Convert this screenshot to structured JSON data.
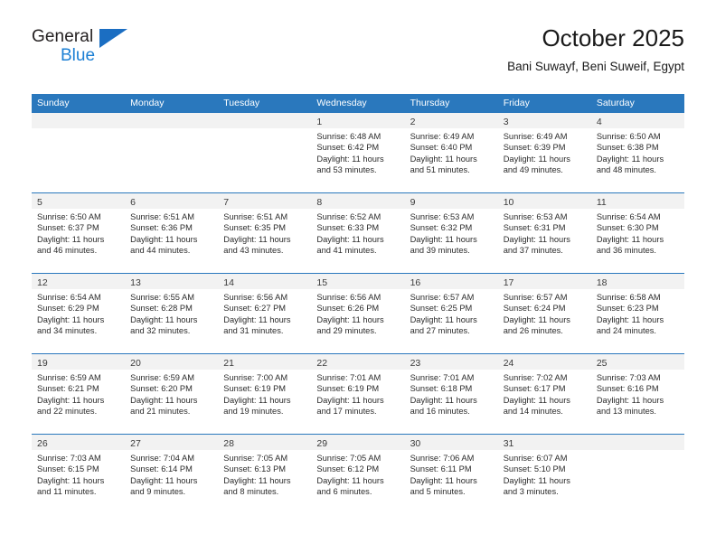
{
  "brand": {
    "line1": "General",
    "line2": "Blue",
    "triangle_color": "#1b6ec2",
    "blue_text_color": "#1b7fd4"
  },
  "header": {
    "title": "October 2025",
    "subtitle": "Bani Suwayf, Beni Suweif, Egypt"
  },
  "theme": {
    "header_blue": "#2a78bd",
    "daynum_band": "#f2f2f2",
    "text": "#2b2b2b"
  },
  "weekdays": [
    "Sunday",
    "Monday",
    "Tuesday",
    "Wednesday",
    "Thursday",
    "Friday",
    "Saturday"
  ],
  "weeks": [
    [
      {
        "day": "",
        "lines": []
      },
      {
        "day": "",
        "lines": []
      },
      {
        "day": "",
        "lines": []
      },
      {
        "day": "1",
        "lines": [
          "Sunrise: 6:48 AM",
          "Sunset: 6:42 PM",
          "Daylight: 11 hours",
          "and 53 minutes."
        ]
      },
      {
        "day": "2",
        "lines": [
          "Sunrise: 6:49 AM",
          "Sunset: 6:40 PM",
          "Daylight: 11 hours",
          "and 51 minutes."
        ]
      },
      {
        "day": "3",
        "lines": [
          "Sunrise: 6:49 AM",
          "Sunset: 6:39 PM",
          "Daylight: 11 hours",
          "and 49 minutes."
        ]
      },
      {
        "day": "4",
        "lines": [
          "Sunrise: 6:50 AM",
          "Sunset: 6:38 PM",
          "Daylight: 11 hours",
          "and 48 minutes."
        ]
      }
    ],
    [
      {
        "day": "5",
        "lines": [
          "Sunrise: 6:50 AM",
          "Sunset: 6:37 PM",
          "Daylight: 11 hours",
          "and 46 minutes."
        ]
      },
      {
        "day": "6",
        "lines": [
          "Sunrise: 6:51 AM",
          "Sunset: 6:36 PM",
          "Daylight: 11 hours",
          "and 44 minutes."
        ]
      },
      {
        "day": "7",
        "lines": [
          "Sunrise: 6:51 AM",
          "Sunset: 6:35 PM",
          "Daylight: 11 hours",
          "and 43 minutes."
        ]
      },
      {
        "day": "8",
        "lines": [
          "Sunrise: 6:52 AM",
          "Sunset: 6:33 PM",
          "Daylight: 11 hours",
          "and 41 minutes."
        ]
      },
      {
        "day": "9",
        "lines": [
          "Sunrise: 6:53 AM",
          "Sunset: 6:32 PM",
          "Daylight: 11 hours",
          "and 39 minutes."
        ]
      },
      {
        "day": "10",
        "lines": [
          "Sunrise: 6:53 AM",
          "Sunset: 6:31 PM",
          "Daylight: 11 hours",
          "and 37 minutes."
        ]
      },
      {
        "day": "11",
        "lines": [
          "Sunrise: 6:54 AM",
          "Sunset: 6:30 PM",
          "Daylight: 11 hours",
          "and 36 minutes."
        ]
      }
    ],
    [
      {
        "day": "12",
        "lines": [
          "Sunrise: 6:54 AM",
          "Sunset: 6:29 PM",
          "Daylight: 11 hours",
          "and 34 minutes."
        ]
      },
      {
        "day": "13",
        "lines": [
          "Sunrise: 6:55 AM",
          "Sunset: 6:28 PM",
          "Daylight: 11 hours",
          "and 32 minutes."
        ]
      },
      {
        "day": "14",
        "lines": [
          "Sunrise: 6:56 AM",
          "Sunset: 6:27 PM",
          "Daylight: 11 hours",
          "and 31 minutes."
        ]
      },
      {
        "day": "15",
        "lines": [
          "Sunrise: 6:56 AM",
          "Sunset: 6:26 PM",
          "Daylight: 11 hours",
          "and 29 minutes."
        ]
      },
      {
        "day": "16",
        "lines": [
          "Sunrise: 6:57 AM",
          "Sunset: 6:25 PM",
          "Daylight: 11 hours",
          "and 27 minutes."
        ]
      },
      {
        "day": "17",
        "lines": [
          "Sunrise: 6:57 AM",
          "Sunset: 6:24 PM",
          "Daylight: 11 hours",
          "and 26 minutes."
        ]
      },
      {
        "day": "18",
        "lines": [
          "Sunrise: 6:58 AM",
          "Sunset: 6:23 PM",
          "Daylight: 11 hours",
          "and 24 minutes."
        ]
      }
    ],
    [
      {
        "day": "19",
        "lines": [
          "Sunrise: 6:59 AM",
          "Sunset: 6:21 PM",
          "Daylight: 11 hours",
          "and 22 minutes."
        ]
      },
      {
        "day": "20",
        "lines": [
          "Sunrise: 6:59 AM",
          "Sunset: 6:20 PM",
          "Daylight: 11 hours",
          "and 21 minutes."
        ]
      },
      {
        "day": "21",
        "lines": [
          "Sunrise: 7:00 AM",
          "Sunset: 6:19 PM",
          "Daylight: 11 hours",
          "and 19 minutes."
        ]
      },
      {
        "day": "22",
        "lines": [
          "Sunrise: 7:01 AM",
          "Sunset: 6:19 PM",
          "Daylight: 11 hours",
          "and 17 minutes."
        ]
      },
      {
        "day": "23",
        "lines": [
          "Sunrise: 7:01 AM",
          "Sunset: 6:18 PM",
          "Daylight: 11 hours",
          "and 16 minutes."
        ]
      },
      {
        "day": "24",
        "lines": [
          "Sunrise: 7:02 AM",
          "Sunset: 6:17 PM",
          "Daylight: 11 hours",
          "and 14 minutes."
        ]
      },
      {
        "day": "25",
        "lines": [
          "Sunrise: 7:03 AM",
          "Sunset: 6:16 PM",
          "Daylight: 11 hours",
          "and 13 minutes."
        ]
      }
    ],
    [
      {
        "day": "26",
        "lines": [
          "Sunrise: 7:03 AM",
          "Sunset: 6:15 PM",
          "Daylight: 11 hours",
          "and 11 minutes."
        ]
      },
      {
        "day": "27",
        "lines": [
          "Sunrise: 7:04 AM",
          "Sunset: 6:14 PM",
          "Daylight: 11 hours",
          "and 9 minutes."
        ]
      },
      {
        "day": "28",
        "lines": [
          "Sunrise: 7:05 AM",
          "Sunset: 6:13 PM",
          "Daylight: 11 hours",
          "and 8 minutes."
        ]
      },
      {
        "day": "29",
        "lines": [
          "Sunrise: 7:05 AM",
          "Sunset: 6:12 PM",
          "Daylight: 11 hours",
          "and 6 minutes."
        ]
      },
      {
        "day": "30",
        "lines": [
          "Sunrise: 7:06 AM",
          "Sunset: 6:11 PM",
          "Daylight: 11 hours",
          "and 5 minutes."
        ]
      },
      {
        "day": "31",
        "lines": [
          "Sunrise: 6:07 AM",
          "Sunset: 5:10 PM",
          "Daylight: 11 hours",
          "and 3 minutes."
        ]
      },
      {
        "day": "",
        "lines": []
      }
    ]
  ]
}
